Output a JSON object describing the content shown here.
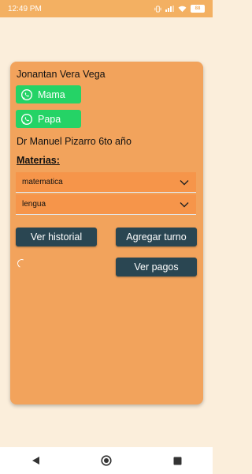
{
  "status_bar": {
    "time": "12:49 PM",
    "battery": "88"
  },
  "student": {
    "name": "Jonantan Vera Vega",
    "school": "Dr Manuel Pizarro 6to año"
  },
  "contacts": [
    {
      "label": "Mama"
    },
    {
      "label": "Papa"
    }
  ],
  "materias": {
    "title": "Materias:",
    "selects": [
      {
        "value": "matematica"
      },
      {
        "value": "lengua"
      }
    ]
  },
  "actions": {
    "historial": "Ver historial",
    "turno": "Agregar turno",
    "pagos": "Ver pagos"
  },
  "colors": {
    "card": "#f2a35c",
    "select": "#f6954a",
    "button": "#2a4652",
    "whatsapp": "#25d366",
    "background": "#fbeedb"
  },
  "icons": [
    "whatsapp-icon",
    "chevron-down-icon",
    "back-icon",
    "home-icon",
    "recents-icon",
    "loading-spinner"
  ]
}
